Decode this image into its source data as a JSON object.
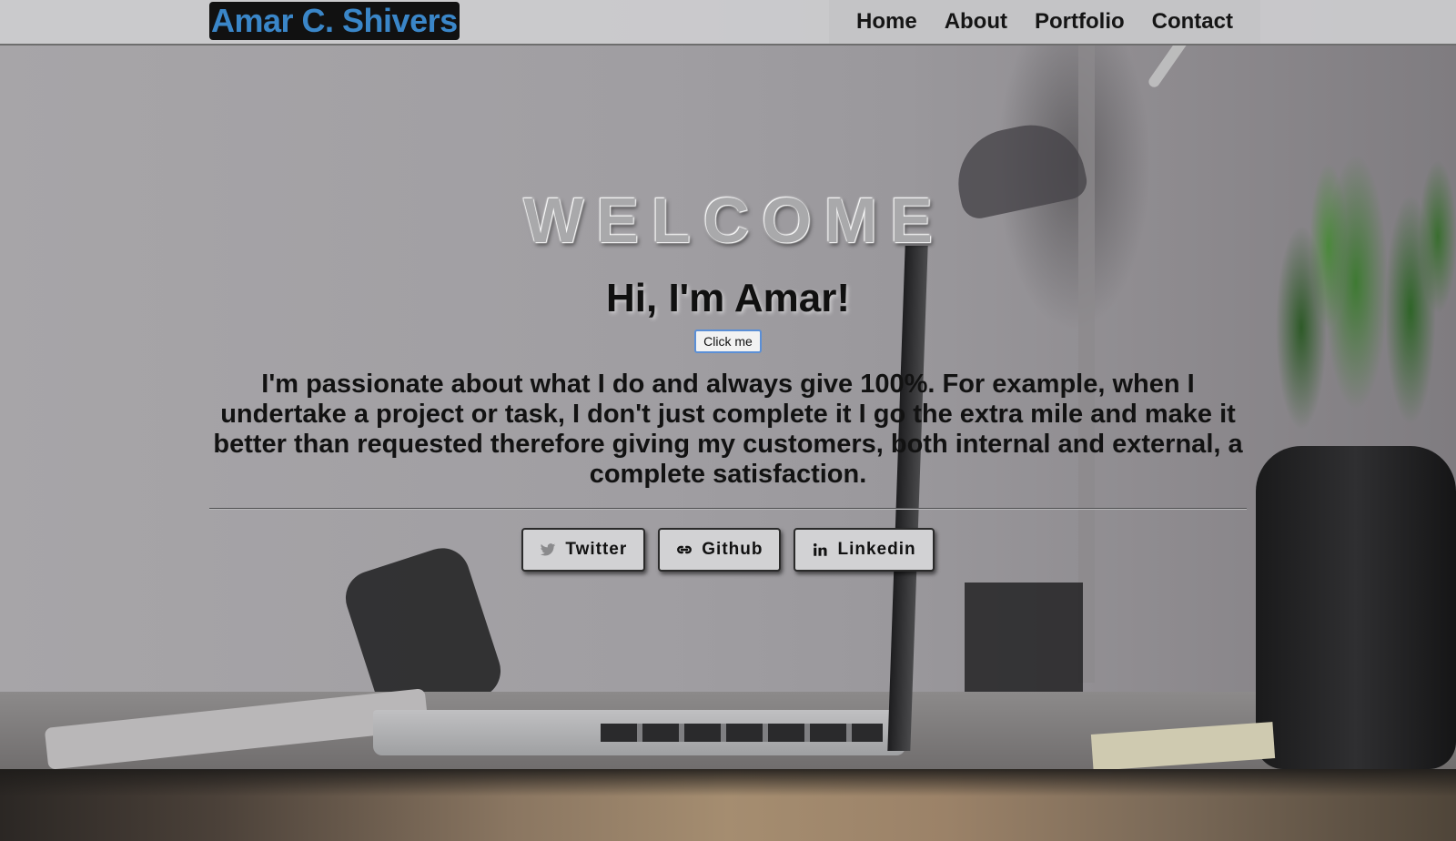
{
  "navbar": {
    "brand": "Amar C. Shivers",
    "links": [
      {
        "label": "Home"
      },
      {
        "label": "About"
      },
      {
        "label": "Portfolio"
      },
      {
        "label": "Contact"
      }
    ]
  },
  "hero": {
    "welcome": "WELCOME",
    "greeting": "Hi, I'm Amar!",
    "button_label": "Click me",
    "blurb": "I'm passionate about what I do and always give 100%. For example, when I undertake a project or task, I don't just complete it I go the extra mile and make it better than requested therefore giving my customers, both internal and external, a complete satisfaction."
  },
  "social": [
    {
      "label": "Twitter",
      "icon": "twitter-icon"
    },
    {
      "label": "Github",
      "icon": "github-icon"
    },
    {
      "label": "Linkedin",
      "icon": "linkedin-icon"
    }
  ],
  "colors": {
    "brand_text": "#3a86c8",
    "brand_bg": "#111111",
    "navbar_bg": "#cdcdcf",
    "button_border": "#5b8fd6"
  }
}
